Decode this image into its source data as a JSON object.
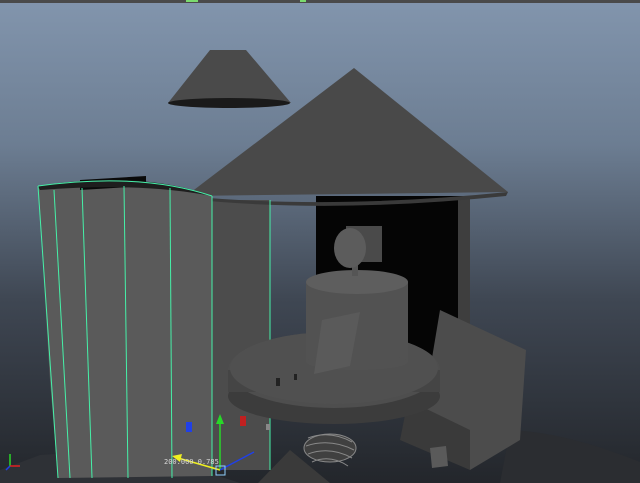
{
  "viewport": {
    "manipulator_readout": "200.000 0.785",
    "colors": {
      "selection_wire": "#46f0a8",
      "axis_x": "#e02020",
      "axis_y": "#28d828",
      "axis_z": "#2040e8",
      "handle_yellow": "#f0f020"
    }
  },
  "icons": {
    "axis_indicator": "axis-indicator-icon",
    "move_manipulator": "move-manipulator-icon"
  }
}
